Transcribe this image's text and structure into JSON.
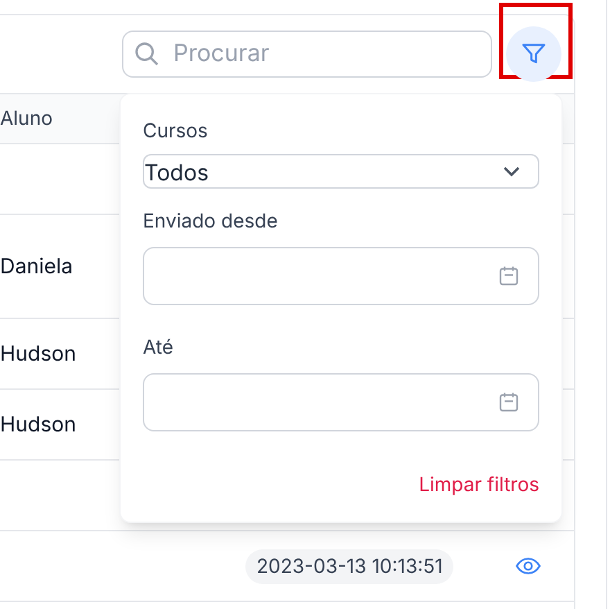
{
  "search": {
    "placeholder": "Procurar"
  },
  "filter_button": {
    "highlighted": true,
    "active": true
  },
  "table": {
    "columns": [
      "Aluno"
    ],
    "rows": [
      {
        "aluno": ""
      },
      {
        "aluno": "Daniela"
      },
      {
        "aluno": "Hudson"
      },
      {
        "aluno": "Hudson"
      },
      {
        "aluno": ""
      },
      {
        "aluno": "",
        "date": "2023-03-13 10:13:51",
        "viewable": true
      }
    ]
  },
  "filter_panel": {
    "courses_label": "Cursos",
    "courses_value": "Todos",
    "from_label": "Enviado desde",
    "to_label": "Até",
    "clear_link": "Limpar filtros"
  }
}
